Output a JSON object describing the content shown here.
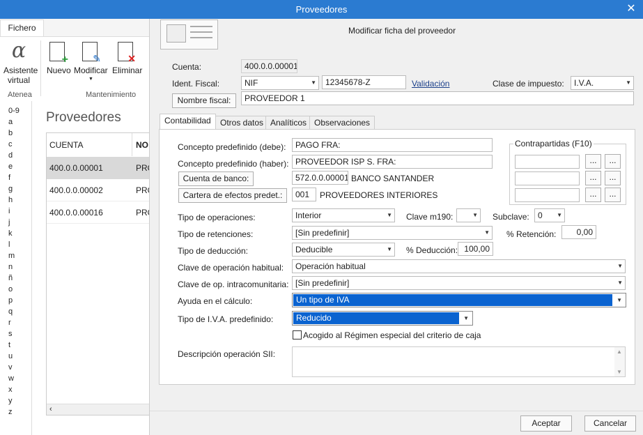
{
  "window": {
    "title": "Proveedores"
  },
  "ribbon": {
    "file_tab": "Fichero",
    "assistant_label_1": "Asistente",
    "assistant_label_2": "virtual",
    "new_label": "Nuevo",
    "modify_label": "Modificar",
    "delete_label": "Eliminar",
    "group_atenea": "Atenea",
    "group_mantenimiento": "Mantenimiento"
  },
  "alphabet": [
    "0-9",
    "a",
    "b",
    "c",
    "d",
    "e",
    "f",
    "g",
    "h",
    "i",
    "j",
    "k",
    "l",
    "m",
    "n",
    "ñ",
    "o",
    "p",
    "q",
    "r",
    "s",
    "t",
    "u",
    "v",
    "w",
    "x",
    "y",
    "z"
  ],
  "list": {
    "heading": "Proveedores",
    "col_cuenta": "CUENTA",
    "col_nombre": "NO",
    "rows": [
      {
        "cuenta": "400.0.0.00001",
        "nombre": "PRO"
      },
      {
        "cuenta": "400.0.0.00002",
        "nombre": "PRO"
      },
      {
        "cuenta": "400.0.0.00016",
        "nombre": "PRO"
      }
    ]
  },
  "form": {
    "heading": "Modificar ficha del proveedor",
    "cuenta_label": "Cuenta:",
    "cuenta_value": "400.0.0.00001",
    "ident_label": "Ident. Fiscal:",
    "ident_type": "NIF",
    "ident_value": "12345678-Z",
    "validacion": "Validación",
    "clase_label": "Clase de impuesto:",
    "clase_value": "I.V.A.",
    "nombre_btn": "Nombre fiscal:",
    "nombre_value": "PROVEEDOR 1",
    "tabs": [
      "Contabilidad",
      "Otros datos",
      "Analíticos",
      "Observaciones"
    ],
    "concepto_debe_label": "Concepto predefinido (debe):",
    "concepto_debe_value": "PAGO FRA:",
    "concepto_haber_label": "Concepto predefinido (haber):",
    "concepto_haber_value": "PROVEEDOR ISP S. FRA:",
    "cuenta_banco_btn": "Cuenta de banco:",
    "cuenta_banco_value": "572.0.0.00001",
    "cuenta_banco_name": "BANCO SANTANDER",
    "cartera_btn": "Cartera de efectos predet.:",
    "cartera_value": "001",
    "cartera_name": "PROVEEDORES INTERIORES",
    "contrapartidas_label": "Contrapartidas (F10)",
    "dots": "...",
    "tipo_op_label": "Tipo de operaciones:",
    "tipo_op_value": "Interior",
    "clave_m190_label": "Clave m190:",
    "clave_m190_value": "",
    "subclave_label": "Subclave:",
    "subclave_value": "0",
    "tipo_ret_label": "Tipo de retenciones:",
    "tipo_ret_value": "[Sin predefinir]",
    "pct_ret_label": "% Retención:",
    "pct_ret_value": "0,00",
    "tipo_ded_label": "Tipo de deducción:",
    "tipo_ded_value": "Deducible",
    "pct_ded_label": "% Deducción:",
    "pct_ded_value": "100,00",
    "clave_hab_label": "Clave de operación habitual:",
    "clave_hab_value": "Operación habitual",
    "clave_intra_label": "Clave de op. intracomunitaria:",
    "clave_intra_value": "[Sin predefinir]",
    "ayuda_label": "Ayuda en el cálculo:",
    "ayuda_value": "Un tipo de IVA",
    "tipo_iva_label": "Tipo de I.V.A. predefinido:",
    "tipo_iva_value": "Reducido",
    "acogido_label": "Acogido al Régimen especial del criterio de caja",
    "descripcion_label": "Descripción operación SII:",
    "aceptar": "Aceptar",
    "cancelar": "Cancelar"
  },
  "colors": {
    "titlebar": "#2b7bd1",
    "selection": "#0a63d0",
    "link": "#1a3f8a"
  }
}
